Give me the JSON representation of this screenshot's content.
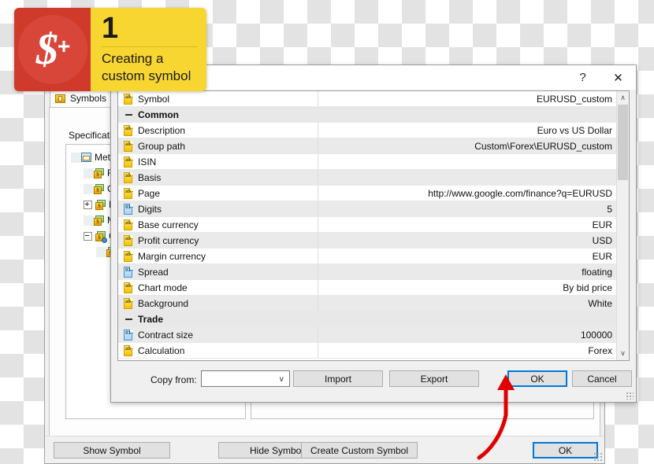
{
  "badge": {
    "symbol": "$",
    "plus": "+",
    "number": "1",
    "line1": "Creating a",
    "line2": "custom symbol",
    "red": "#cf3a2a",
    "yellow": "#f7d632"
  },
  "background_window": {
    "tab_label": "Symbols",
    "tab_icon": "symbols-folder-icon",
    "spec_label": "Specificatio",
    "tree": [
      {
        "label": "MetaTra",
        "indent": 0,
        "expander": "none",
        "icon": "chart-window-icon"
      },
      {
        "label": "For",
        "indent": 1,
        "expander": "none",
        "icon": "folder-dollar-icon"
      },
      {
        "label": "CFI",
        "indent": 1,
        "expander": "none",
        "icon": "folder-dollar-icon"
      },
      {
        "label": "MO",
        "indent": 1,
        "expander": "plus",
        "icon": "folder-dollar-icon"
      },
      {
        "label": "Me",
        "indent": 1,
        "expander": "none",
        "icon": "folder-dollar-icon"
      },
      {
        "label": "Cus",
        "indent": 1,
        "expander": "minus",
        "icon": "folder-dollar-gear-icon"
      },
      {
        "label": "",
        "indent": 2,
        "expander": "none",
        "icon": "folder-dollar-gear-icon"
      }
    ],
    "buttons": [
      {
        "label": "Show Symbol",
        "name": "show-symbol-button",
        "default": false
      },
      {
        "label": "Hide Symbol",
        "name": "hide-symbol-button",
        "default": false
      },
      {
        "label": "Create Custom Symbol",
        "name": "create-custom-symbol-button",
        "default": false
      },
      {
        "label": "OK",
        "name": "bgwin-ok-button",
        "default": true
      }
    ]
  },
  "dialog": {
    "titlebar": {
      "help_glyph": "?",
      "close_glyph": "✕"
    },
    "rows": [
      {
        "type": "item",
        "icon": "text-property-icon",
        "name": "Symbol",
        "value": "EURUSD_custom"
      },
      {
        "type": "group",
        "icon": "collapse-icon",
        "name": "Common",
        "value": ""
      },
      {
        "type": "item",
        "icon": "text-property-icon",
        "name": "Description",
        "value": "Euro vs US Dollar"
      },
      {
        "type": "item",
        "icon": "text-property-icon",
        "name": "Group path",
        "value": "Custom\\Forex\\EURUSD_custom"
      },
      {
        "type": "item",
        "icon": "text-property-icon",
        "name": "ISIN",
        "value": ""
      },
      {
        "type": "item",
        "icon": "text-property-icon",
        "name": "Basis",
        "value": ""
      },
      {
        "type": "item",
        "icon": "text-property-icon",
        "name": "Page",
        "value": "http://www.google.com/finance?q=EURUSD"
      },
      {
        "type": "item",
        "icon": "number-property-icon",
        "name": "Digits",
        "value": "5"
      },
      {
        "type": "item",
        "icon": "text-property-icon",
        "name": "Base currency",
        "value": "EUR"
      },
      {
        "type": "item",
        "icon": "text-property-icon",
        "name": "Profit currency",
        "value": "USD"
      },
      {
        "type": "item",
        "icon": "text-property-icon",
        "name": "Margin currency",
        "value": "EUR"
      },
      {
        "type": "item",
        "icon": "number-property-icon",
        "name": "Spread",
        "value": "floating"
      },
      {
        "type": "item",
        "icon": "text-property-icon",
        "name": "Chart mode",
        "value": "By bid price"
      },
      {
        "type": "item",
        "icon": "text-property-icon",
        "name": "Background",
        "value": "White"
      },
      {
        "type": "group",
        "icon": "collapse-icon",
        "name": "Trade",
        "value": ""
      },
      {
        "type": "item",
        "icon": "number-property-icon",
        "name": "Contract size",
        "value": "100000"
      },
      {
        "type": "item",
        "icon": "text-property-icon",
        "name": "Calculation",
        "value": "Forex"
      }
    ],
    "scrollbar": {
      "up_glyph": "∧",
      "down_glyph": "∨"
    },
    "footer": {
      "copy_from_label": "Copy from:",
      "copy_from_value": "",
      "copy_from_chevron": "∨",
      "buttons": [
        {
          "label": "Import",
          "name": "import-button",
          "default": false
        },
        {
          "label": "Export",
          "name": "export-button",
          "default": false
        },
        {
          "label": "OK",
          "name": "dialog-ok-button",
          "default": true
        },
        {
          "label": "Cancel",
          "name": "dialog-cancel-button",
          "default": false
        }
      ]
    }
  },
  "annotation": {
    "arrow_color": "#e00000"
  }
}
